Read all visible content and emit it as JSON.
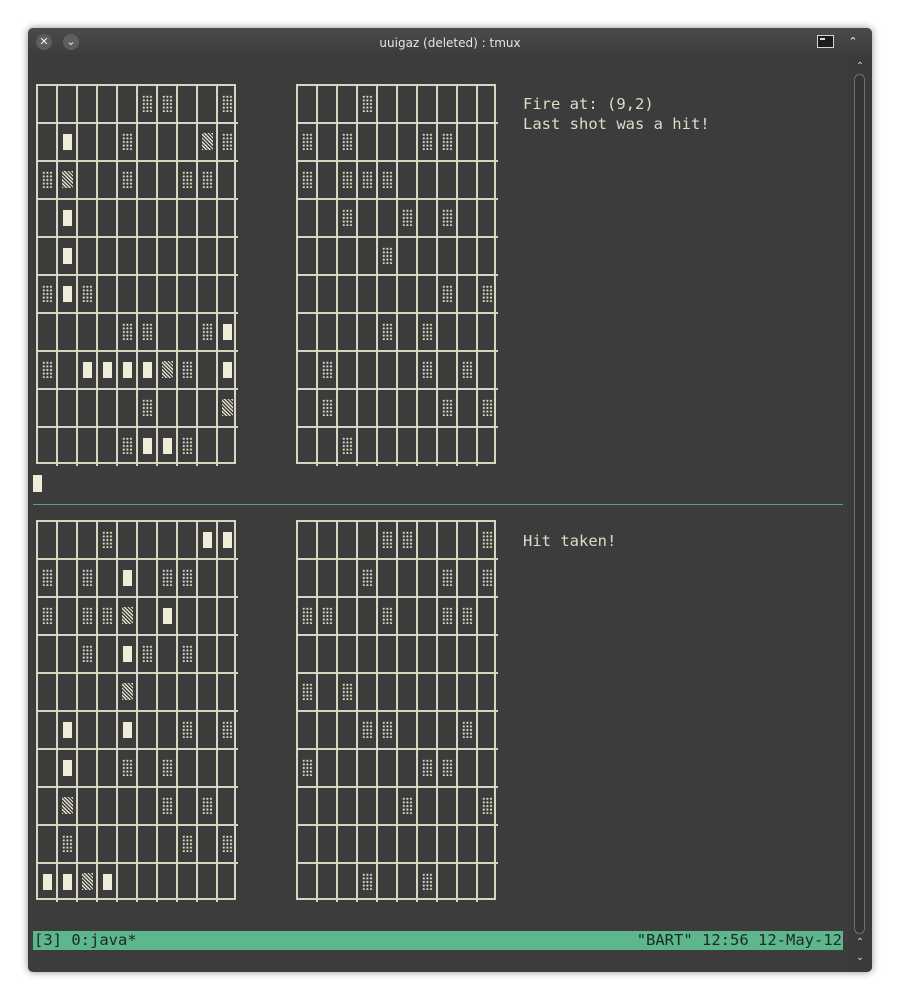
{
  "window": {
    "title": "uuigaz (deleted) : tmux",
    "close_glyph": "✕",
    "menu_glyph": "⌄",
    "keep_above_glyph": "⌃"
  },
  "panes": [
    {
      "message_lines": [
        "Fire at: (9,2)",
        "Last shot was a hit!"
      ],
      "own_board": [
        "_____mm__m",
        "_s__m___hm",
        "mh__m__mm_",
        "_s________",
        "_s________",
        "msm_______",
        "____mm__ms",
        "m_sssshm_s",
        "_____m___h",
        "____mssm__"
      ],
      "target_board": [
        "___m______",
        "m_m___mm__",
        "m_mmm_____",
        "__m__m_m__",
        "____m_____",
        "_______m_m",
        "____m_m___",
        "_m____m_m_",
        "_m_____m_m",
        "__m_______"
      ]
    },
    {
      "message_lines": [
        "Hit taken!"
      ],
      "own_board": [
        "___m____ss",
        "m_m_s_mm__",
        "m_mmh_s___",
        "__m_sm_m__",
        "____h_____",
        "_s__s__m_m",
        "_s__m_m___",
        "_h____m_m_",
        "_m_____m_m",
        "sshs______"
      ],
      "target_board": [
        "____mm___m",
        "___m___m_m",
        "mm__m__mm_",
        "__________",
        "m_m_______",
        "___mm___m_",
        "m_____mm__",
        "_____m___m",
        "__________",
        "___m__m___"
      ]
    }
  ],
  "statusbar": {
    "left": "[3] 0:java*",
    "right": "\"BART\" 12:56 12-May-12"
  },
  "scrollbar": {
    "up_glyph": "⌃",
    "down_glyph": "⌄"
  },
  "colors": {
    "terminal_bg": "#3c3c3c",
    "grid_line": "#d8d6c0",
    "ship": "#efedd8",
    "status_bar": "#5db68d",
    "pane_divider": "#4fa883"
  }
}
